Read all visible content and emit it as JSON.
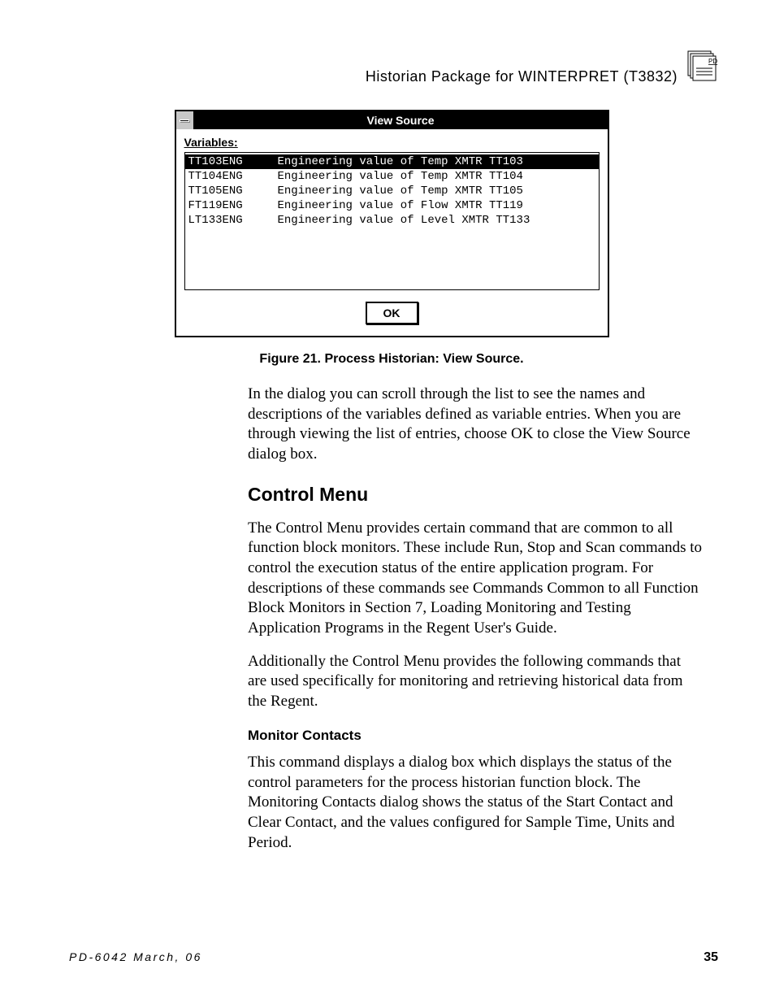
{
  "header": {
    "title_a": "Historian   Package   for W",
    "title_b": "INTERPRET",
    "title_c": " (T3832)",
    "icon_text": "PD"
  },
  "dialog": {
    "title": "View Source",
    "label": "Variables:",
    "rows": [
      {
        "name": "TT103ENG",
        "desc": "Engineering value of Temp XMTR TT103",
        "selected": true
      },
      {
        "name": "TT104ENG",
        "desc": "Engineering value of Temp XMTR TT104",
        "selected": false
      },
      {
        "name": "TT105ENG",
        "desc": "Engineering value of Temp XMTR TT105",
        "selected": false
      },
      {
        "name": "FT119ENG",
        "desc": "Engineering value of Flow XMTR TT119",
        "selected": false
      },
      {
        "name": "LT133ENG",
        "desc": "Engineering value of Level XMTR TT133",
        "selected": false
      }
    ],
    "ok_label": "OK"
  },
  "caption": "Figure 21.  Process Historian: View Source.",
  "body": {
    "p1": "In the dialog you can scroll through the list to see the names and descriptions of the variables defined as variable entries. When you are through viewing the list of entries, choose OK to close the View Source dialog box.",
    "h2": "Control Menu",
    "p2": "The Control Menu provides certain command that are common to all function block monitors.  These include Run, Stop and Scan commands to control the execution status of the entire application program.  For descriptions of these commands see Commands Common to all Function Block Monitors in Section 7, Loading Monitoring and Testing Application Programs in the Regent User's Guide.",
    "p3": "Additionally the Control Menu provides the following commands that are used specifically for monitoring and retrieving historical data from the Regent.",
    "h3": "Monitor Contacts",
    "p4": "This command displays a dialog box which displays the status of the control parameters for the process historian function block.  The Monitoring Contacts dialog shows the status of the Start Contact and Clear Contact, and the values configured for Sample Time, Units and Period."
  },
  "footer": {
    "left": "PD-6042 March, 06",
    "right": "35"
  }
}
